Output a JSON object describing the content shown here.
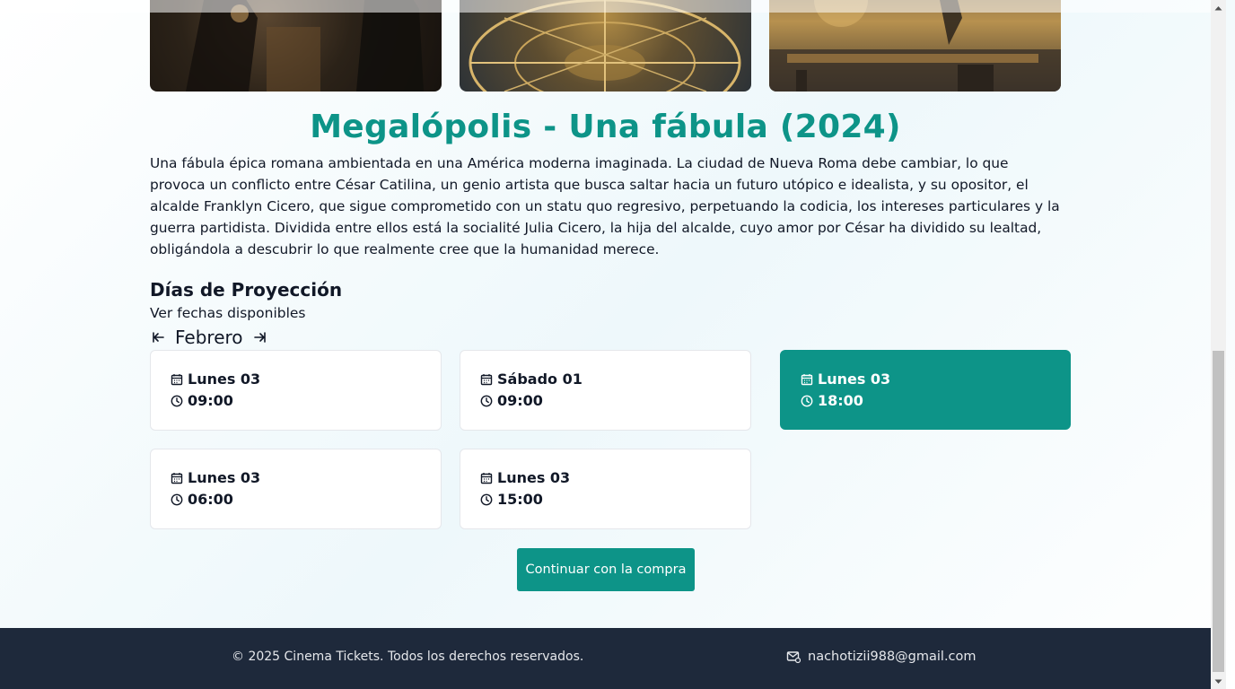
{
  "movie": {
    "title": "Megalópolis - Una fábula (2024)",
    "synopsis": "Una fábula épica romana ambientada en una América moderna imaginada. La ciudad de Nueva Roma debe cambiar, lo que provoca un conflicto entre César Catilina, un genio artista que busca saltar hacia un futuro utópico e idealista, y su opositor, el alcalde Franklyn Cicero, que sigue comprometido con un statu quo regresivo, perpetuando la codicia, los intereses particulares y la guerra partidista. Dividida entre ellos está la socialité Julia Cicero, la hija del alcalde, cuyo amor por César ha dividido su lealtad, obligándola a descubrir lo que realmente cree que la humanidad merece."
  },
  "schedule": {
    "heading": "Días de Proyección",
    "subheading": "Ver fechas disponibles",
    "month": "Febrero",
    "showtimes": [
      {
        "day": "Lunes 03",
        "time": "09:00",
        "selected": false
      },
      {
        "day": "Sábado 01",
        "time": "09:00",
        "selected": false
      },
      {
        "day": "Lunes 03",
        "time": "18:00",
        "selected": true
      },
      {
        "day": "Lunes 03",
        "time": "06:00",
        "selected": false
      },
      {
        "day": "Lunes 03",
        "time": "15:00",
        "selected": false
      }
    ]
  },
  "actions": {
    "continue_label": "Continuar con la compra"
  },
  "footer": {
    "copyright": "© 2025 Cinema Tickets. Todos los derechos reservados.",
    "email": "nachotizii988@gmail.com"
  },
  "colors": {
    "accent": "#0d9488",
    "footer_bg": "#1e293b"
  },
  "icons": {
    "prev": "arrow-left-icon",
    "next": "arrow-right-icon",
    "date": "calendar-icon",
    "time": "clock-icon",
    "email": "mail-icon"
  }
}
